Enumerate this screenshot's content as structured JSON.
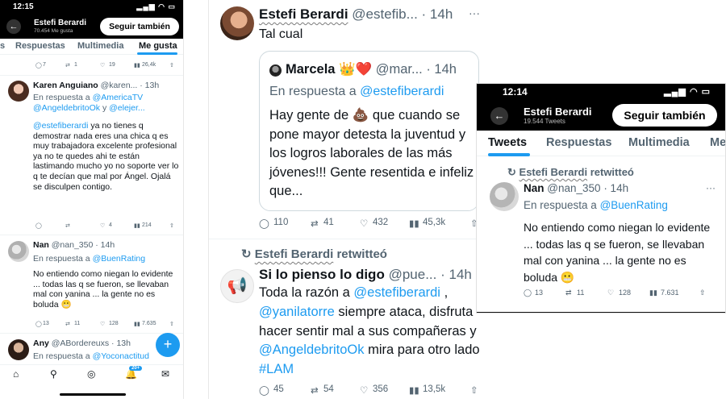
{
  "left_phone": {
    "time": "12:15",
    "signal": "▂▄▆ ◠ ▭",
    "back_icon": "←",
    "profile_name": "Estefi Berardi",
    "profile_sub": "70.454 Me gusta",
    "follow_label": "Seguir también",
    "tabs": [
      "s",
      "Respuestas",
      "Multimedia",
      "Me gusta"
    ],
    "top_actions": {
      "replies": "7",
      "retweets": "1",
      "likes": "19",
      "views": "26,4k"
    },
    "posts": [
      {
        "author": "Karen Anguiano",
        "handle": "@karen...",
        "time": "· 13h",
        "reply_prefix": "En respuesta a",
        "reply_to": "@AmericaTV",
        "reply_to_2": "@AngeldebritoOk",
        "reply_join": "y",
        "reply_to_3": "@elejer...",
        "mention": "@estefiberardi",
        "body": " ya no tienes q demostrar nada eres una chica q es muy trabajadora  excelente profesional ya no  te quedes ahi te están lastimando mucho yo no soporte ver lo q te decían que mal por Ángel. Ojalá se disculpen contigo.",
        "actions": {
          "replies": "",
          "retweets": "",
          "likes": "4",
          "views": "214"
        }
      },
      {
        "author": "Nan",
        "handle": "@nan_350",
        "time": "· 14h",
        "reply_prefix": "En respuesta a",
        "reply_to": "@BuenRating",
        "body": "No entiendo como niegan lo evidente ... todas las q se fueron, se llevaban mal con yanina ... la gente no es boluda 😬",
        "actions": {
          "replies": "13",
          "retweets": "11",
          "likes": "128",
          "views": "7.635"
        }
      },
      {
        "author": "Any",
        "handle": "@ABordereuxs",
        "time": "· 13h",
        "reply_prefix": "En respuesta a",
        "reply_to": "@Yoconactitud"
      }
    ],
    "fab_label": "+",
    "nav_badge": "20+"
  },
  "middle": {
    "author": "Estefi Berardi",
    "handle": "@estefib...",
    "time": "· 14h",
    "text": "Tal cual",
    "quote": {
      "author": "Marcela 👑❤️",
      "handle": "@mar...",
      "time": "· 14h",
      "reply_prefix": "En respuesta a",
      "reply_to": "@estefiberardi",
      "body": "Hay gente de 💩 que cuando se pone mayor detesta la juventud y los logros laborales de las más jóvenes!!! Gente resentida e infeliz que..."
    },
    "actions1": {
      "replies": "110",
      "retweets": "41",
      "likes": "432",
      "views": "45,3k"
    },
    "retweet_by": "Estefi Berardi",
    "retweet_suffix": "retwitteó",
    "tweet2": {
      "author": "Si lo pienso lo digo",
      "handle": "@pue...",
      "time": "· 14h",
      "body_1": "Toda la razón a ",
      "mention_1": "@estefiberardi",
      "body_2": " , ",
      "mention_2": "@yanilatorre",
      "body_3": " siempre ataca, disfruta hacer sentir mal a sus compañeras y ",
      "mention_3": "@AngeldebritoOk",
      "body_4": " mira para otro lado ",
      "hashtag": "#LAM"
    },
    "actions2": {
      "replies": "45",
      "retweets": "54",
      "likes": "356",
      "views": "13,5k"
    }
  },
  "right_phone": {
    "time": "12:14",
    "signal": "▂▄▆ ◠ ▭",
    "back_icon": "←",
    "profile_name": "Estefi Berardi",
    "profile_sub": "19.544 Tweets",
    "follow_label": "Seguir también",
    "tabs": [
      "Tweets",
      "Respuestas",
      "Multimedia",
      "Me"
    ],
    "retweet_by": "Estefi Berardi",
    "retweet_suffix": "retwitteó",
    "author": "Nan",
    "handle": "@nan_350",
    "time_ago": "· 14h",
    "reply_prefix": "En respuesta a",
    "reply_to": "@BuenRating",
    "body": "No entiendo como niegan lo evidente ... todas las q se fueron, se llevaban mal con yanina ... la gente no es boluda 😬",
    "actions": {
      "replies": "13",
      "retweets": "11",
      "likes": "128",
      "views": "7.631"
    }
  },
  "icons": {
    "reply": "◯",
    "retweet": "⇄",
    "like": "♡",
    "views": "▮▮",
    "share": "⇧",
    "dots": "···",
    "retweet_small": "↻"
  },
  "colors": {
    "link": "#1d9bf0",
    "muted": "#536471",
    "text": "#0f1419",
    "bar": "#000000"
  }
}
